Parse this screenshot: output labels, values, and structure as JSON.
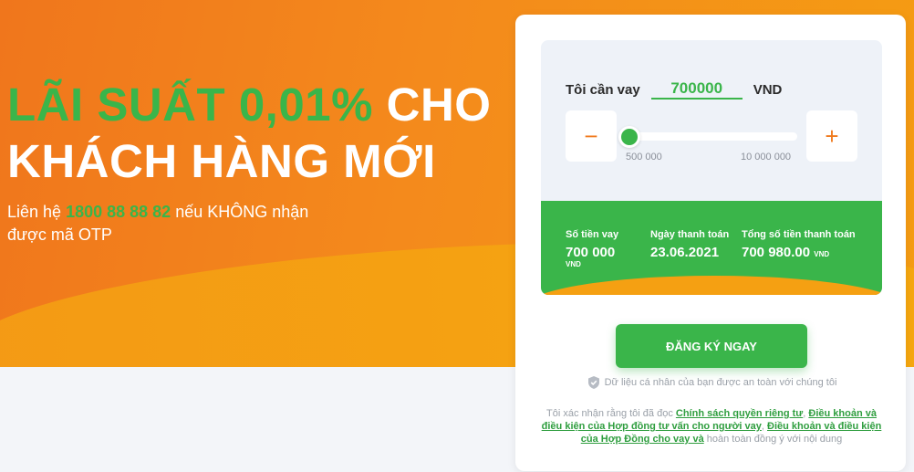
{
  "hero": {
    "title_highlight": "LÃI SUẤT 0,01%",
    "title_rest_line1": " CHO",
    "title_line2": "KHÁCH HÀNG MỚI",
    "sub_prefix": "Liên hệ ",
    "sub_phone": "1800 88 88 82",
    "sub_suffix": " nếu KHÔNG nhận được mã OTP"
  },
  "calculator": {
    "label": "Tôi cần vay",
    "amount_value": "700000",
    "currency": "VND",
    "slider_min_label": "500 000",
    "slider_max_label": "10 000 000",
    "slider_fraction": 0.02,
    "minus_symbol": "−",
    "plus_symbol": "+"
  },
  "summary": {
    "loan_amount_label": "Số tiền vay",
    "loan_amount_value": "700 000",
    "loan_amount_unit": "VND",
    "payment_date_label": "Ngày thanh toán",
    "payment_date_value": "23.06.2021",
    "total_label": "Tổng số tiền thanh toán",
    "total_value": "700 980.00",
    "total_unit": "VND"
  },
  "actions": {
    "register_label": "ĐĂNG KÝ NGAY",
    "secure_text": "Dữ liệu cá nhân của bạn được an toàn với chúng tôi"
  },
  "consent": {
    "prefix": "Tôi xác nhận rằng tôi đã đọc ",
    "link1": "Chính sách quyền riêng tư",
    "sep1": ", ",
    "link2": "Điều khoản và điều kiện của Hợp đồng tư vấn cho người vay",
    "sep2": ", ",
    "link3": "Điều khoản và điều kiện của Hợp Đồng cho vay và",
    "suffix": " hoàn toàn đồng ý với nội dung"
  },
  "colors": {
    "brand_green": "#3ab54a",
    "brand_orange": "#f07a1e"
  }
}
